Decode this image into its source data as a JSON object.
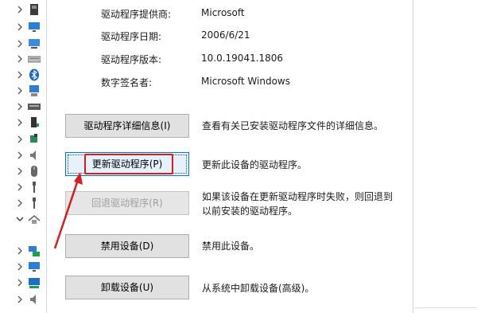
{
  "tree": {
    "items": [
      {
        "icon": "chip-icon"
      },
      {
        "icon": "monitor-icon"
      },
      {
        "icon": "monitor-icon"
      },
      {
        "icon": "keyboard-icon"
      },
      {
        "icon": "bluetooth-icon"
      },
      {
        "icon": "computer-icon"
      },
      {
        "icon": "keyboard-icon"
      },
      {
        "icon": "device-icon"
      },
      {
        "icon": "puzzle-icon"
      },
      {
        "icon": "speaker-icon"
      },
      {
        "icon": "mouse-icon"
      },
      {
        "icon": "usb-icon"
      },
      {
        "icon": "usb-icon"
      },
      {
        "icon": "camera-icon"
      },
      {
        "icon": "network-icon"
      },
      {
        "icon": "monitor-icon"
      },
      {
        "icon": "speaker-icon"
      }
    ]
  },
  "properties": [
    {
      "label": "驱动程序提供商:",
      "value": "Microsoft"
    },
    {
      "label": "驱动程序日期:",
      "value": "2006/6/21"
    },
    {
      "label": "驱动程序版本:",
      "value": "10.0.19041.1806"
    },
    {
      "label": "数字签名者:",
      "value": "Microsoft Windows"
    }
  ],
  "actions": {
    "details": {
      "label": "驱动程序详细信息(I)",
      "desc": "查看有关已安装驱动程序文件的详细信息。"
    },
    "update": {
      "label": "更新驱动程序(P)",
      "desc": "更新此设备的驱动程序。"
    },
    "rollback": {
      "label": "回退驱动程序(R)",
      "desc_line1": "如果该设备在更新驱动程序时失败，则回退到",
      "desc_line2": "以前安装的驱动程序。"
    },
    "disable": {
      "label": "禁用设备(D)",
      "desc": "禁用此设备。"
    },
    "uninstall": {
      "label": "卸载设备(U)",
      "desc": "从系统中卸载设备(高级)。"
    }
  },
  "colors": {
    "annotation": "#d91c1c",
    "focus_border": "#0078d7"
  }
}
